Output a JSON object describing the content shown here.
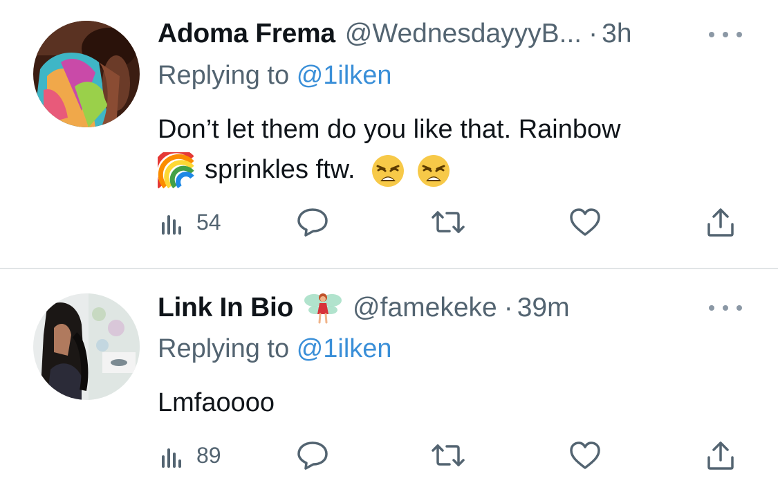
{
  "tweets": [
    {
      "display_name": "Adoma Frema",
      "handle": "@WednesdayyyB...",
      "dot": "·",
      "time": "3h",
      "replying_prefix": "Replying to",
      "replying_to": "@1ilken",
      "body_line1": "Don’t let them do you like that. Rainbow",
      "body_line2": "sprinkles ftw.",
      "views": "54",
      "icons": [
        "rainbow-emoji",
        "weary-face-emoji",
        "weary-face-emoji"
      ]
    },
    {
      "display_name": "Link In Bio",
      "handle": "@famekeke",
      "dot": "·",
      "time": "39m",
      "replying_prefix": "Replying to",
      "replying_to": "@1ilken",
      "body": "Lmfaoooo",
      "views": "89",
      "icons": [
        "fairy-emoji"
      ]
    }
  ],
  "colors": {
    "text_primary": "#0f1419",
    "text_secondary": "#536471",
    "mention": "#3a8fd8",
    "divider": "#e1e4e6"
  },
  "action_icons": [
    "views-icon",
    "reply-icon",
    "retweet-icon",
    "like-icon",
    "share-icon",
    "more-icon"
  ]
}
